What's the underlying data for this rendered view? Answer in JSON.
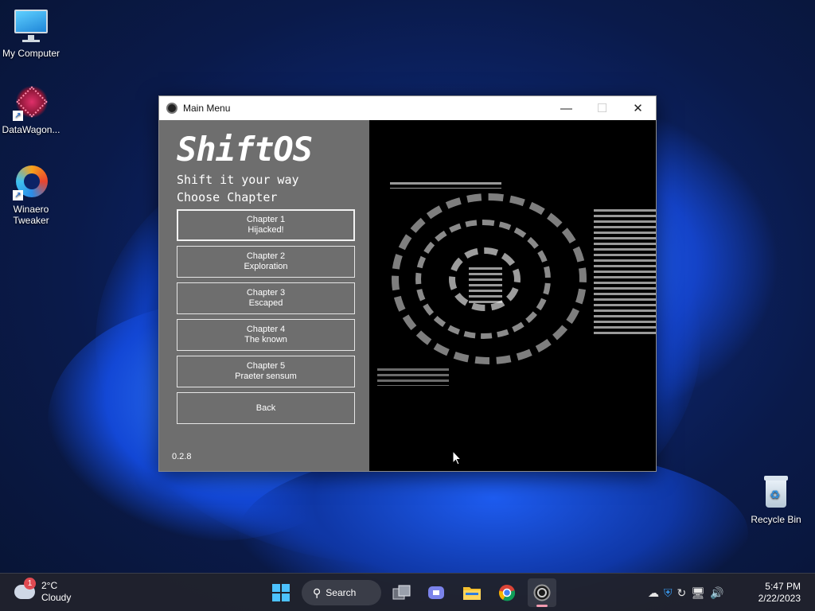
{
  "desktop": {
    "icons": [
      {
        "label": "My Computer"
      },
      {
        "label": "DataWagon..."
      },
      {
        "label": "Winaero Tweaker"
      },
      {
        "label": "Recycle Bin"
      }
    ]
  },
  "window": {
    "title": "Main Menu",
    "brand": "ShiftOS",
    "tagline": "Shift it your way",
    "choose_label": "Choose Chapter",
    "chapters": [
      {
        "line1": "Chapter 1",
        "line2": "Hijacked!"
      },
      {
        "line1": "Chapter 2",
        "line2": "Exploration"
      },
      {
        "line1": "Chapter 3",
        "line2": "Escaped"
      },
      {
        "line1": "Chapter 4",
        "line2": "The known"
      },
      {
        "line1": "Chapter 5",
        "line2": "Praeter sensum"
      }
    ],
    "back_label": "Back",
    "version": "0.2.8",
    "controls": {
      "minimize": "—",
      "maximize": "☐",
      "close": "✕"
    }
  },
  "taskbar": {
    "weather": {
      "temp": "2°C",
      "condition": "Cloudy",
      "badge": "1"
    },
    "search_label": "Search",
    "time": "5:47 PM",
    "date": "2/22/2023"
  }
}
